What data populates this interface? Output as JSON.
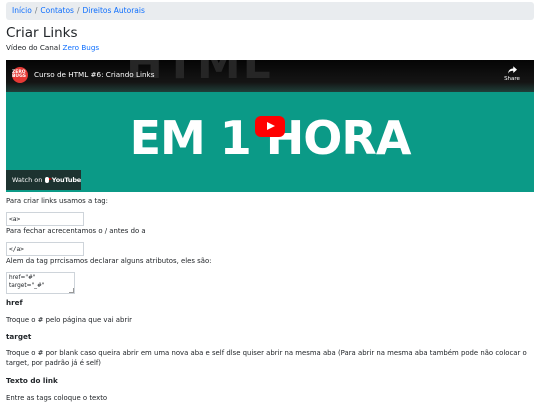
{
  "breadcrumb": {
    "items": [
      {
        "label": "Início"
      },
      {
        "label": "Contatos"
      },
      {
        "label": "Direitos Autorais"
      }
    ],
    "separator": "/"
  },
  "title": "Criar Links",
  "subtitle": {
    "prefix": "Vídeo do Canal",
    "link": "Zero Bugs"
  },
  "video": {
    "channel_badge": "ZERO BUGS",
    "title": "Curso de HTML #6: Criando Links",
    "share_label": "Share",
    "headline": "EM 1 HORA",
    "watch_on": "Watch on",
    "platform": "YouTube",
    "background_color": "#0b9a87"
  },
  "content": {
    "p1": "Para criar links usamos a tag:",
    "code1": "<a>",
    "p2": "Para fechar acrecentamos o / antes do a",
    "code2": "</a>",
    "p3": "Alem da tag prrcisamos declarar alguns atributos, eles são:",
    "code3": "href=\"#\"\ntarget=\"_#\"",
    "h_href": "href",
    "p_href": "Troque o # pelo página que vai abrir",
    "h_target": "target",
    "p_target": "Troque o # por blank caso queira abrir em uma nova aba e self dlse quiser abrir na mesma aba (Para abrir na mesma aba também pode não colocar o target, por padrão já é self)",
    "h_text": "Texto do link",
    "p_text": "Entre as tags coloque o texto"
  },
  "colors": {
    "link": "#0d6efd",
    "breadcrumb_bg": "#e9ecef",
    "play_button": "#ff0000"
  }
}
